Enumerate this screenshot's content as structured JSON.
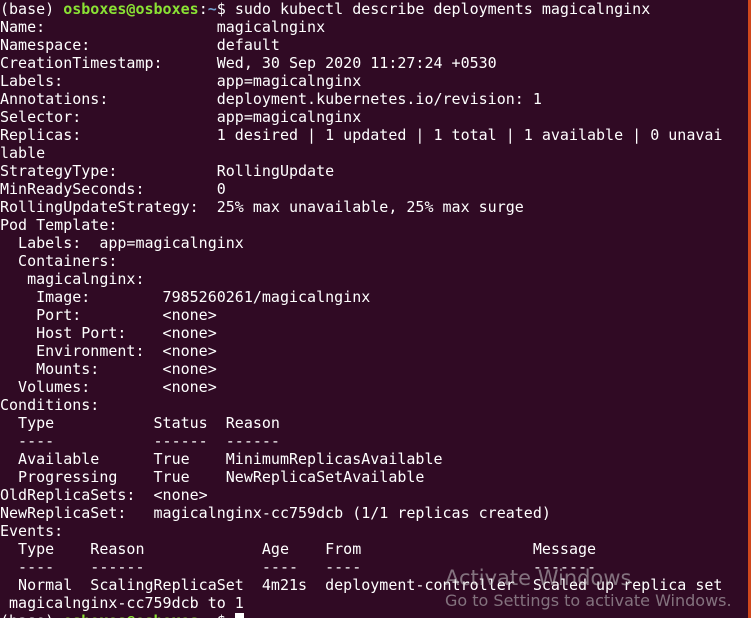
{
  "prompt": {
    "env": "(base) ",
    "user_host": "osboxes@osboxes",
    "sep": ":",
    "path": "~",
    "symbol": "$ ",
    "command": "sudo kubectl describe deployments magicalnginx"
  },
  "output_lines": [
    "Name:                   magicalnginx",
    "Namespace:              default",
    "CreationTimestamp:      Wed, 30 Sep 2020 11:27:24 +0530",
    "Labels:                 app=magicalnginx",
    "Annotations:            deployment.kubernetes.io/revision: 1",
    "Selector:               app=magicalnginx",
    "Replicas:               1 desired | 1 updated | 1 total | 1 available | 0 unavai",
    "lable",
    "StrategyType:           RollingUpdate",
    "MinReadySeconds:        0",
    "RollingUpdateStrategy:  25% max unavailable, 25% max surge",
    "Pod Template:",
    "  Labels:  app=magicalnginx",
    "  Containers:",
    "   magicalnginx:",
    "    Image:        7985260261/magicalnginx",
    "    Port:         <none>",
    "    Host Port:    <none>",
    "    Environment:  <none>",
    "    Mounts:       <none>",
    "  Volumes:        <none>",
    "Conditions:",
    "  Type           Status  Reason",
    "  ----           ------  ------",
    "  Available      True    MinimumReplicasAvailable",
    "  Progressing    True    NewReplicaSetAvailable",
    "OldReplicaSets:  <none>",
    "NewReplicaSet:   magicalnginx-cc759dcb (1/1 replicas created)",
    "Events:",
    "  Type    Reason             Age    From                   Message",
    "  ----    ------             ----   ----                   -------",
    "  Normal  ScalingReplicaSet  4m21s  deployment-controller  Scaled up replica set",
    " magicalnginx-cc759dcb to 1"
  ],
  "watermark": {
    "title": "Activate Windows",
    "subtitle": "Go to Settings to activate Windows."
  },
  "colors": {
    "background": "#300a24",
    "prompt_user": "#8ae234",
    "prompt_path": "#729fcf",
    "text": "#ffffff"
  }
}
